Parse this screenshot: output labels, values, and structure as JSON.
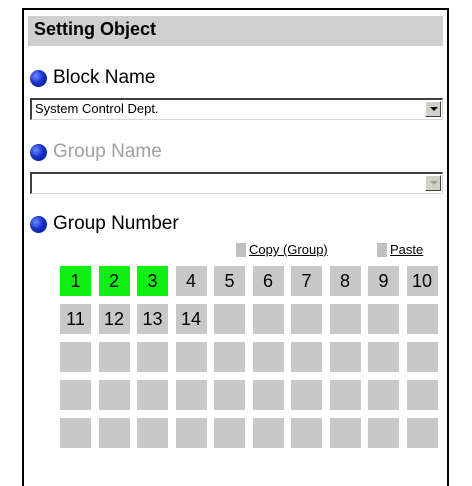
{
  "header": {
    "title": "Setting Object"
  },
  "block": {
    "label": "Block Name",
    "value": "System Control Dept."
  },
  "group_name": {
    "label": "Group Name",
    "value": ""
  },
  "group_number": {
    "label": "Group Number",
    "copy_label": "Copy (Group)",
    "paste_label": "Paste",
    "cells": [
      "1",
      "2",
      "3",
      "4",
      "5",
      "6",
      "7",
      "8",
      "9",
      "10",
      "11",
      "12",
      "13",
      "14",
      "",
      "",
      "",
      "",
      "",
      "",
      "",
      "",
      "",
      "",
      "",
      "",
      "",
      "",
      "",
      "",
      "",
      "",
      "",
      "",
      "",
      "",
      "",
      "",
      "",
      "",
      "",
      "",
      "",
      "",
      "",
      "",
      "",
      "",
      "",
      ""
    ],
    "selected": [
      "1",
      "2",
      "3"
    ]
  },
  "colors": {
    "selected": "#11ee11",
    "cell": "#c8c8c8",
    "header": "#cfcfcf",
    "dot": "#1533c9"
  },
  "icons": [
    "block-bullet-icon",
    "group-name-bullet-icon",
    "group-number-bullet-icon",
    "dropdown-arrow-icon"
  ]
}
